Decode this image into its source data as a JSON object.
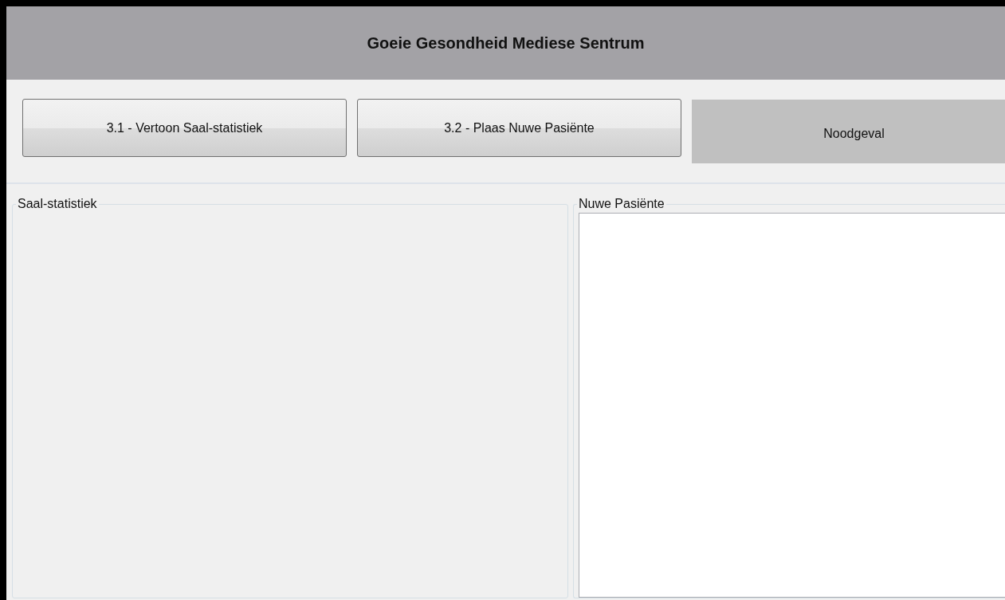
{
  "window": {
    "title": "Goeie Gesondheid Mediese Sentrum"
  },
  "buttons": [
    {
      "label": "3.1 - Vertoon Saal-statistiek",
      "kind": "raised"
    },
    {
      "label": "3.2 - Plaas Nuwe Pasiënte",
      "kind": "raised"
    },
    {
      "label": "Noodgeval",
      "kind": "flat"
    }
  ],
  "groups": [
    {
      "title": "Saal-statistiek",
      "kind": "empty"
    },
    {
      "title": "Nuwe Pasiënte",
      "kind": "textbox"
    }
  ]
}
